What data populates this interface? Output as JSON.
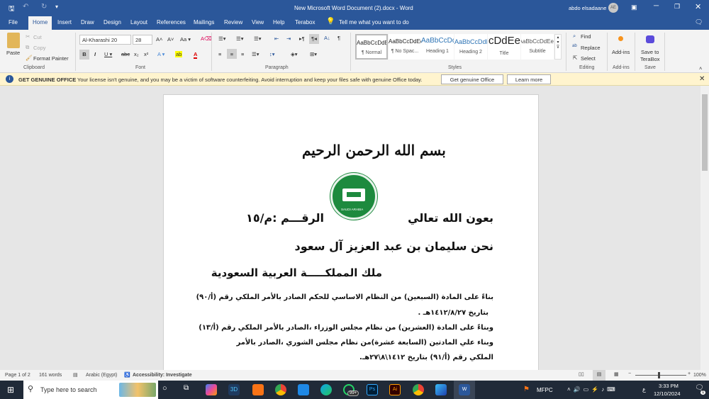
{
  "titlebar": {
    "title": "New Microsoft Word Document (2).docx  -  Word",
    "user": "abdo elsadaane",
    "avatar": "AE"
  },
  "tabs": [
    "File",
    "Home",
    "Insert",
    "Draw",
    "Design",
    "Layout",
    "References",
    "Mailings",
    "Review",
    "View",
    "Help",
    "Terabox"
  ],
  "tell_me": "Tell me what you want to do",
  "clipboard": {
    "paste": "Paste",
    "cut": "Cut",
    "copy": "Copy",
    "format_painter": "Format Painter",
    "label": "Clipboard"
  },
  "font": {
    "name": "Al-Kharashi 20",
    "size": "28",
    "label": "Font"
  },
  "paragraph": {
    "label": "Paragraph"
  },
  "styles": {
    "items": [
      {
        "preview": "AaBbCcDdEe",
        "name": "¶ Normal"
      },
      {
        "preview": "AaBbCcDdEe",
        "name": "¶ No Spac..."
      },
      {
        "preview": "AaBbCcDdEe",
        "name": "Heading 1"
      },
      {
        "preview": "AaBbCcDdEe",
        "name": "Heading 2"
      },
      {
        "preview": "AaBbCcDdEe",
        "name": "Title"
      },
      {
        "preview": "AaBbCcDdEe",
        "name": "Subtitle"
      }
    ],
    "label": "Styles"
  },
  "editing": {
    "find": "Find",
    "replace": "Replace",
    "select": "Select",
    "label": "Editing"
  },
  "addins": {
    "button": "Add-ins",
    "label": "Add-ins"
  },
  "save": {
    "button1": "Save to",
    "button2": "TeraBox",
    "label": "Save"
  },
  "message": {
    "title": "GET GENUINE OFFICE",
    "text": "Your license isn't genuine, and you may be a victim of software counterfeiting. Avoid interruption and keep your files safe with genuine Office today.",
    "btn1": "Get genuine Office",
    "btn2": "Learn more"
  },
  "document": {
    "basmala": "بسم الله الرحمن الرحيم",
    "emblem": "SAUDI ARABIA",
    "line1": "بعون الله تعالي",
    "number": "الرقـــم :م/١٥",
    "line2": "نحن سليمان بن عبد العزيز آل سعود",
    "line3": "ملك المملكـــــة العربية السعودية",
    "paras": [
      "بناءً على المادة (السبعين) من النظام الاساسي للحكم الصادر بالأمر الملكي رقم (أ/٩٠)",
      "بتاريخ ١٤١٢/٨/٢٧هـ .",
      "وبناءً على المادة (العشرين) من نظام مجلس الوزراء ،الصادر بالأمر الملكي رقم (أ/١٣)",
      "وبناء علي المادتين (السابعة عشرة)من نظام مجلس الشوري ،الصادر بالأمر",
      "الملكي رقم (أ/٩١) بتاريخ ١٤١٢\\٨\\٢٧هـ."
    ]
  },
  "status": {
    "page": "Page 1 of 2",
    "words": "161 words",
    "lang": "Arabic (Egypt)",
    "access": "Accessibility: Investigate",
    "zoom": "100%"
  },
  "taskbar": {
    "search": "Type here to search",
    "badge": "99+",
    "mfpc": "MFPC",
    "lang": "ع",
    "time": "3:33 PM",
    "date": "12/10/2024",
    "notif": "1"
  }
}
